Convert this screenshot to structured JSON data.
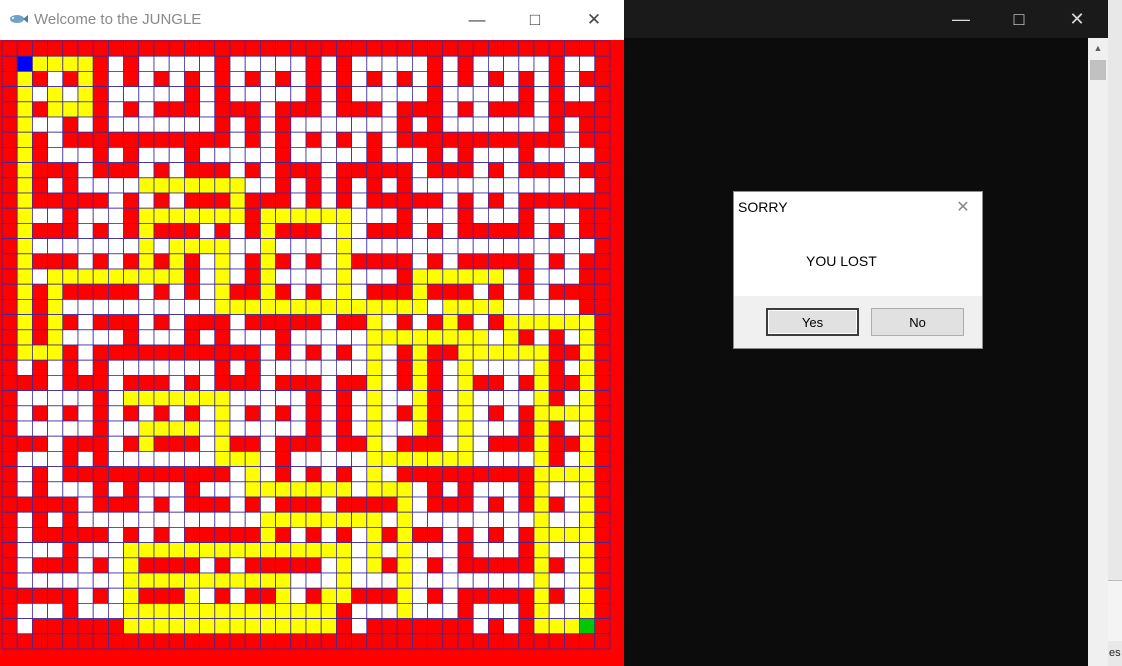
{
  "maze_window": {
    "title": "Welcome to the JUNGLE",
    "icons": {
      "app": "fish-icon",
      "minimize": "minimize-icon",
      "maximize": "maximize-icon",
      "close": "close-icon"
    },
    "colors": {
      "wall": "#ff0000",
      "open": "#ffffff",
      "path": "#ffff00",
      "start": "#0000ff",
      "goal": "#00c800",
      "grid": "#3a2a9a"
    },
    "maze": {
      "rows": 40,
      "cols": 40,
      "start": [
        1,
        1
      ],
      "goal": [
        38,
        38
      ],
      "path_cells": [
        [
          1,
          1
        ],
        [
          1,
          2
        ],
        [
          1,
          3
        ],
        [
          1,
          4
        ],
        [
          1,
          5
        ],
        [
          2,
          1
        ],
        [
          2,
          5
        ],
        [
          3,
          1
        ],
        [
          3,
          3
        ],
        [
          3,
          5
        ],
        [
          4,
          1
        ],
        [
          4,
          3
        ],
        [
          4,
          4
        ],
        [
          4,
          5
        ],
        [
          5,
          1
        ],
        [
          6,
          1
        ],
        [
          7,
          1
        ],
        [
          8,
          1
        ],
        [
          9,
          1
        ],
        [
          10,
          1
        ],
        [
          11,
          1
        ],
        [
          12,
          1
        ],
        [
          13,
          1
        ],
        [
          14,
          1
        ],
        [
          15,
          1
        ],
        [
          16,
          1
        ],
        [
          17,
          1
        ],
        [
          18,
          1
        ],
        [
          19,
          1
        ],
        [
          20,
          1
        ],
        [
          20,
          2
        ],
        [
          20,
          3
        ],
        [
          19,
          3
        ],
        [
          18,
          3
        ],
        [
          17,
          3
        ],
        [
          16,
          3
        ],
        [
          15,
          3
        ],
        [
          15,
          4
        ],
        [
          15,
          5
        ],
        [
          15,
          6
        ],
        [
          15,
          7
        ],
        [
          15,
          8
        ],
        [
          15,
          9
        ],
        [
          15,
          10
        ],
        [
          15,
          11
        ],
        [
          14,
          11
        ],
        [
          13,
          11
        ],
        [
          13,
          12
        ],
        [
          13,
          13
        ],
        [
          13,
          14
        ],
        [
          14,
          14
        ],
        [
          15,
          14
        ],
        [
          16,
          14
        ],
        [
          17,
          14
        ],
        [
          17,
          15
        ],
        [
          17,
          16
        ],
        [
          17,
          17
        ],
        [
          17,
          18
        ],
        [
          17,
          19
        ],
        [
          17,
          20
        ],
        [
          17,
          21
        ],
        [
          17,
          22
        ],
        [
          17,
          23
        ],
        [
          17,
          24
        ],
        [
          18,
          24
        ],
        [
          19,
          24
        ],
        [
          20,
          24
        ],
        [
          21,
          24
        ],
        [
          22,
          24
        ],
        [
          23,
          24
        ],
        [
          24,
          24
        ],
        [
          25,
          24
        ],
        [
          26,
          24
        ],
        [
          19,
          25
        ],
        [
          19,
          26
        ],
        [
          19,
          27
        ],
        [
          19,
          28
        ],
        [
          19,
          29
        ],
        [
          19,
          30
        ],
        [
          19,
          31
        ],
        [
          18,
          29
        ],
        [
          17,
          29
        ],
        [
          17,
          30
        ],
        [
          17,
          31
        ],
        [
          17,
          32
        ],
        [
          20,
          27
        ],
        [
          21,
          27
        ],
        [
          22,
          27
        ],
        [
          23,
          27
        ],
        [
          24,
          27
        ],
        [
          25,
          27
        ],
        [
          27,
          24
        ],
        [
          28,
          24
        ],
        [
          29,
          24
        ],
        [
          29,
          25
        ],
        [
          29,
          26
        ],
        [
          30,
          26
        ],
        [
          31,
          26
        ],
        [
          32,
          26
        ],
        [
          33,
          26
        ],
        [
          34,
          26
        ],
        [
          35,
          26
        ],
        [
          36,
          26
        ],
        [
          37,
          26
        ],
        [
          27,
          25
        ],
        [
          27,
          26
        ],
        [
          27,
          27
        ],
        [
          27,
          28
        ],
        [
          27,
          29
        ],
        [
          27,
          30
        ],
        [
          26,
          30
        ],
        [
          25,
          30
        ],
        [
          24,
          30
        ],
        [
          23,
          30
        ],
        [
          22,
          30
        ],
        [
          21,
          30
        ],
        [
          20,
          30
        ],
        [
          20,
          31
        ],
        [
          20,
          32
        ],
        [
          20,
          33
        ],
        [
          20,
          34
        ],
        [
          20,
          35
        ],
        [
          21,
          35
        ],
        [
          22,
          35
        ],
        [
          23,
          35
        ],
        [
          24,
          35
        ],
        [
          25,
          35
        ],
        [
          26,
          35
        ],
        [
          27,
          35
        ],
        [
          28,
          35
        ],
        [
          29,
          35
        ],
        [
          30,
          35
        ],
        [
          31,
          35
        ],
        [
          32,
          35
        ],
        [
          33,
          35
        ],
        [
          34,
          35
        ],
        [
          35,
          35
        ],
        [
          36,
          35
        ],
        [
          37,
          35
        ],
        [
          38,
          35
        ],
        [
          38,
          36
        ],
        [
          38,
          37
        ],
        [
          38,
          38
        ],
        [
          11,
          9
        ],
        [
          11,
          10
        ],
        [
          11,
          11
        ],
        [
          11,
          12
        ],
        [
          11,
          13
        ],
        [
          11,
          14
        ],
        [
          11,
          15
        ],
        [
          10,
          15
        ],
        [
          9,
          15
        ],
        [
          9,
          14
        ],
        [
          9,
          13
        ],
        [
          9,
          12
        ],
        [
          9,
          11
        ],
        [
          9,
          10
        ],
        [
          9,
          9
        ],
        [
          12,
          9
        ],
        [
          13,
          9
        ],
        [
          14,
          9
        ],
        [
          12,
          17
        ],
        [
          13,
          17
        ],
        [
          14,
          17
        ],
        [
          15,
          17
        ],
        [
          16,
          17
        ],
        [
          11,
          17
        ],
        [
          11,
          18
        ],
        [
          11,
          19
        ],
        [
          11,
          20
        ],
        [
          11,
          21
        ],
        [
          11,
          22
        ],
        [
          12,
          22
        ],
        [
          13,
          22
        ],
        [
          14,
          22
        ],
        [
          15,
          22
        ],
        [
          16,
          22
        ],
        [
          17,
          25
        ],
        [
          17,
          26
        ],
        [
          17,
          27
        ],
        [
          16,
          27
        ],
        [
          15,
          27
        ],
        [
          15,
          28
        ],
        [
          15,
          29
        ],
        [
          15,
          30
        ],
        [
          15,
          31
        ],
        [
          15,
          32
        ],
        [
          18,
          33
        ],
        [
          19,
          33
        ],
        [
          18,
          34
        ],
        [
          18,
          35
        ],
        [
          18,
          36
        ],
        [
          18,
          37
        ],
        [
          18,
          38
        ],
        [
          19,
          38
        ],
        [
          20,
          38
        ],
        [
          21,
          38
        ],
        [
          22,
          38
        ],
        [
          23,
          38
        ],
        [
          24,
          38
        ],
        [
          25,
          38
        ],
        [
          26,
          38
        ],
        [
          27,
          38
        ],
        [
          28,
          38
        ],
        [
          29,
          38
        ],
        [
          30,
          38
        ],
        [
          31,
          38
        ],
        [
          32,
          38
        ],
        [
          33,
          38
        ],
        [
          34,
          38
        ],
        [
          35,
          38
        ],
        [
          36,
          38
        ],
        [
          37,
          38
        ],
        [
          24,
          36
        ],
        [
          24,
          37
        ],
        [
          28,
          36
        ],
        [
          28,
          37
        ],
        [
          32,
          36
        ],
        [
          32,
          37
        ],
        [
          37,
          8
        ],
        [
          37,
          9
        ],
        [
          37,
          10
        ],
        [
          37,
          11
        ],
        [
          37,
          12
        ],
        [
          37,
          13
        ],
        [
          37,
          14
        ],
        [
          37,
          15
        ],
        [
          37,
          16
        ],
        [
          37,
          17
        ],
        [
          37,
          18
        ],
        [
          37,
          19
        ],
        [
          37,
          20
        ],
        [
          37,
          21
        ],
        [
          38,
          8
        ],
        [
          38,
          9
        ],
        [
          38,
          10
        ],
        [
          38,
          11
        ],
        [
          38,
          12
        ],
        [
          38,
          13
        ],
        [
          38,
          14
        ],
        [
          38,
          15
        ],
        [
          38,
          16
        ],
        [
          38,
          17
        ],
        [
          38,
          18
        ],
        [
          38,
          19
        ],
        [
          38,
          20
        ],
        [
          38,
          21
        ],
        [
          36,
          8
        ],
        [
          35,
          8
        ],
        [
          35,
          9
        ],
        [
          35,
          10
        ],
        [
          35,
          11
        ],
        [
          35,
          12
        ],
        [
          35,
          13
        ],
        [
          35,
          14
        ],
        [
          35,
          15
        ],
        [
          35,
          16
        ],
        [
          35,
          17
        ],
        [
          35,
          18
        ],
        [
          36,
          12
        ],
        [
          36,
          18
        ],
        [
          36,
          21
        ],
        [
          36,
          22
        ],
        [
          35,
          22
        ],
        [
          34,
          22
        ],
        [
          33,
          22
        ],
        [
          33,
          21
        ],
        [
          33,
          20
        ],
        [
          33,
          19
        ],
        [
          33,
          18
        ],
        [
          33,
          17
        ],
        [
          33,
          16
        ],
        [
          33,
          15
        ],
        [
          33,
          14
        ],
        [
          33,
          13
        ],
        [
          33,
          12
        ],
        [
          33,
          11
        ],
        [
          33,
          10
        ],
        [
          33,
          9
        ],
        [
          33,
          8
        ],
        [
          34,
          8
        ],
        [
          31,
          17
        ],
        [
          32,
          17
        ],
        [
          31,
          18
        ],
        [
          31,
          19
        ],
        [
          31,
          20
        ],
        [
          31,
          21
        ],
        [
          31,
          22
        ],
        [
          31,
          23
        ],
        [
          31,
          24
        ],
        [
          32,
          24
        ],
        [
          33,
          24
        ],
        [
          34,
          24
        ],
        [
          23,
          8
        ],
        [
          23,
          9
        ],
        [
          23,
          10
        ],
        [
          23,
          11
        ],
        [
          23,
          12
        ],
        [
          23,
          13
        ],
        [
          23,
          14
        ],
        [
          24,
          14
        ],
        [
          25,
          14
        ],
        [
          26,
          14
        ],
        [
          27,
          14
        ],
        [
          27,
          15
        ],
        [
          27,
          16
        ],
        [
          28,
          16
        ],
        [
          29,
          16
        ],
        [
          29,
          17
        ],
        [
          29,
          18
        ],
        [
          29,
          19
        ],
        [
          29,
          20
        ],
        [
          29,
          21
        ],
        [
          29,
          22
        ],
        [
          25,
          9
        ],
        [
          25,
          10
        ],
        [
          25,
          11
        ],
        [
          25,
          12
        ],
        [
          26,
          9
        ]
      ]
    }
  },
  "console_window": {
    "icons": {
      "minimize": "minimize-icon",
      "maximize": "maximize-icon",
      "close": "close-icon",
      "scroll_up": "scroll-up-icon"
    },
    "edge_text": "es"
  },
  "dialog": {
    "title": "SORRY",
    "message": "YOU LOST",
    "close_icon": "close-icon",
    "buttons": {
      "yes": "Yes",
      "no": "No"
    }
  }
}
